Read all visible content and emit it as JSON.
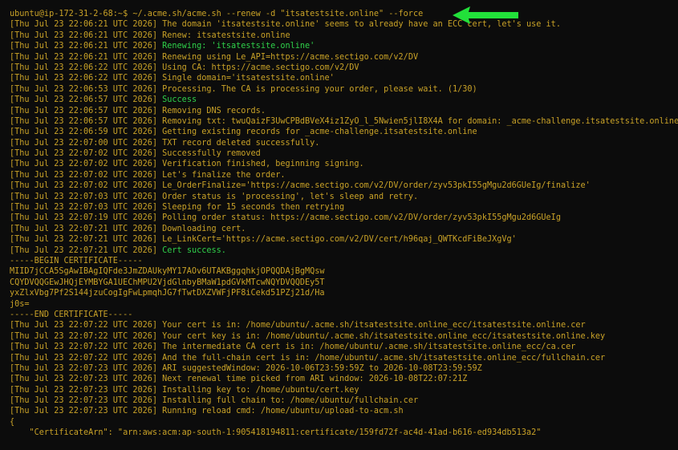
{
  "terminal": {
    "prompt": "ubuntu@ip-172-31-2-68:~$ ~/.acme.sh/acme.sh --renew -d \"itsatestsite.online\" --force",
    "log": [
      {
        "ts": "[Thu Jul 23 22:06:21 UTC 2026]",
        "msg": " The domain 'itsatestsite.online' seems to already have an ECC cert, let's use it.",
        "color": "yellow"
      },
      {
        "ts": "[Thu Jul 23 22:06:21 UTC 2026]",
        "msg": " Renew: itsatestsite.online",
        "color": "yellow"
      },
      {
        "ts": "[Thu Jul 23 22:06:21 UTC 2026]",
        "msg": " Renewing: 'itsatestsite.online'",
        "color": "green"
      },
      {
        "ts": "[Thu Jul 23 22:06:21 UTC 2026]",
        "msg": " Renewing using Le_API=https://acme.sectigo.com/v2/DV",
        "color": "yellow"
      },
      {
        "ts": "[Thu Jul 23 22:06:22 UTC 2026]",
        "msg": " Using CA: https://acme.sectigo.com/v2/DV",
        "color": "yellow"
      },
      {
        "ts": "[Thu Jul 23 22:06:22 UTC 2026]",
        "msg": " Single domain='itsatestsite.online'",
        "color": "yellow"
      },
      {
        "ts": "[Thu Jul 23 22:06:53 UTC 2026]",
        "msg": " Processing. The CA is processing your order, please wait. (1/30)",
        "color": "yellow"
      },
      {
        "ts": "[Thu Jul 23 22:06:57 UTC 2026]",
        "msg": " Success",
        "color": "green"
      },
      {
        "ts": "[Thu Jul 23 22:06:57 UTC 2026]",
        "msg": " Removing DNS records.",
        "color": "yellow"
      },
      {
        "ts": "[Thu Jul 23 22:06:57 UTC 2026]",
        "msg": " Removing txt: twuQaizF3UwCPBdBVeX4iz1ZyO_l_5Nwien5jlI8X4A for domain: _acme-challenge.itsatestsite.online",
        "color": "yellow"
      },
      {
        "ts": "[Thu Jul 23 22:06:59 UTC 2026]",
        "msg": " Getting existing records for _acme-challenge.itsatestsite.online",
        "color": "yellow"
      },
      {
        "ts": "[Thu Jul 23 22:07:00 UTC 2026]",
        "msg": " TXT record deleted successfully.",
        "color": "yellow"
      },
      {
        "ts": "[Thu Jul 23 22:07:02 UTC 2026]",
        "msg": " Successfully removed",
        "color": "yellow"
      },
      {
        "ts": "[Thu Jul 23 22:07:02 UTC 2026]",
        "msg": " Verification finished, beginning signing.",
        "color": "yellow"
      },
      {
        "ts": "[Thu Jul 23 22:07:02 UTC 2026]",
        "msg": " Let's finalize the order.",
        "color": "yellow"
      },
      {
        "ts": "[Thu Jul 23 22:07:02 UTC 2026]",
        "msg": " Le_OrderFinalize='https://acme.sectigo.com/v2/DV/order/zyv53pkI55gMgu2d6GUeIg/finalize'",
        "color": "yellow"
      },
      {
        "ts": "[Thu Jul 23 22:07:03 UTC 2026]",
        "msg": " Order status is 'processing', let's sleep and retry.",
        "color": "yellow"
      },
      {
        "ts": "[Thu Jul 23 22:07:03 UTC 2026]",
        "msg": " Sleeping for 15 seconds then retrying",
        "color": "yellow"
      },
      {
        "ts": "[Thu Jul 23 22:07:19 UTC 2026]",
        "msg": " Polling order status: https://acme.sectigo.com/v2/DV/order/zyv53pkI55gMgu2d6GUeIg",
        "color": "yellow"
      },
      {
        "ts": "[Thu Jul 23 22:07:21 UTC 2026]",
        "msg": " Downloading cert.",
        "color": "yellow"
      },
      {
        "ts": "[Thu Jul 23 22:07:21 UTC 2026]",
        "msg": " Le_LinkCert='https://acme.sectigo.com/v2/DV/cert/h96qaj_QWTKcdFiBeJXgVg'",
        "color": "yellow"
      },
      {
        "ts": "[Thu Jul 23 22:07:21 UTC 2026]",
        "msg": " Cert success.",
        "color": "green"
      }
    ],
    "cert": [
      "-----BEGIN CERTIFICATE-----",
      "MIID7jCCA5SgAwIBAgIQFde3JmZDAUkyMY17AOv6UTAKBggqhkjOPQQDAjBgMQsw",
      "CQYDVQQGEwJHQjEYMBYGA1UEChMPU2VjdGlnbyBMaW1pdGVkMTcwNQYDVQQDEy5T",
      "yxZlxVbg7Pf2S144jzuCogIgFwLpmqhJG7fTwtDXZVWFjPF8iCekd51PZj21d/Ha",
      "j0s=",
      "-----END CERTIFICATE-----"
    ],
    "log2": [
      {
        "ts": "[Thu Jul 23 22:07:22 UTC 2026]",
        "msg": " Your cert is in: /home/ubuntu/.acme.sh/itsatestsite.online_ecc/itsatestsite.online.cer"
      },
      {
        "ts": "[Thu Jul 23 22:07:22 UTC 2026]",
        "msg": " Your cert key is in: /home/ubuntu/.acme.sh/itsatestsite.online_ecc/itsatestsite.online.key"
      },
      {
        "ts": "[Thu Jul 23 22:07:22 UTC 2026]",
        "msg": " The intermediate CA cert is in: /home/ubuntu/.acme.sh/itsatestsite.online_ecc/ca.cer"
      },
      {
        "ts": "[Thu Jul 23 22:07:22 UTC 2026]",
        "msg": " And the full-chain cert is in: /home/ubuntu/.acme.sh/itsatestsite.online_ecc/fullchain.cer"
      },
      {
        "ts": "[Thu Jul 23 22:07:23 UTC 2026]",
        "msg": " ARI suggestedWindow: 2026-10-06T23:59:59Z to 2026-10-08T23:59:59Z"
      },
      {
        "ts": "[Thu Jul 23 22:07:23 UTC 2026]",
        "msg": " Next renewal time picked from ARI window: 2026-10-08T22:07:21Z"
      },
      {
        "ts": "[Thu Jul 23 22:07:23 UTC 2026]",
        "msg": " Installing key to: /home/ubuntu/cert.key"
      },
      {
        "ts": "[Thu Jul 23 22:07:23 UTC 2026]",
        "msg": " Installing full chain to: /home/ubuntu/fullchain.cer"
      },
      {
        "ts": "[Thu Jul 23 22:07:23 UTC 2026]",
        "msg": " Running reload cmd: /home/ubuntu/upload-to-acm.sh"
      }
    ],
    "json_open": "{",
    "json_line": "    \"CertificateArn\": \"arn:aws:acm:ap-south-1:905418194811:certificate/159fd72f-ac4d-41ad-b616-ed934db513a2\""
  },
  "annotation": {
    "arrow_color": "#22e03a",
    "arrow_icon": "arrow-left-icon"
  },
  "colors": {
    "background": "#0c0c0c",
    "text_yellow": "#c9a227",
    "text_green": "#2fd14a"
  }
}
